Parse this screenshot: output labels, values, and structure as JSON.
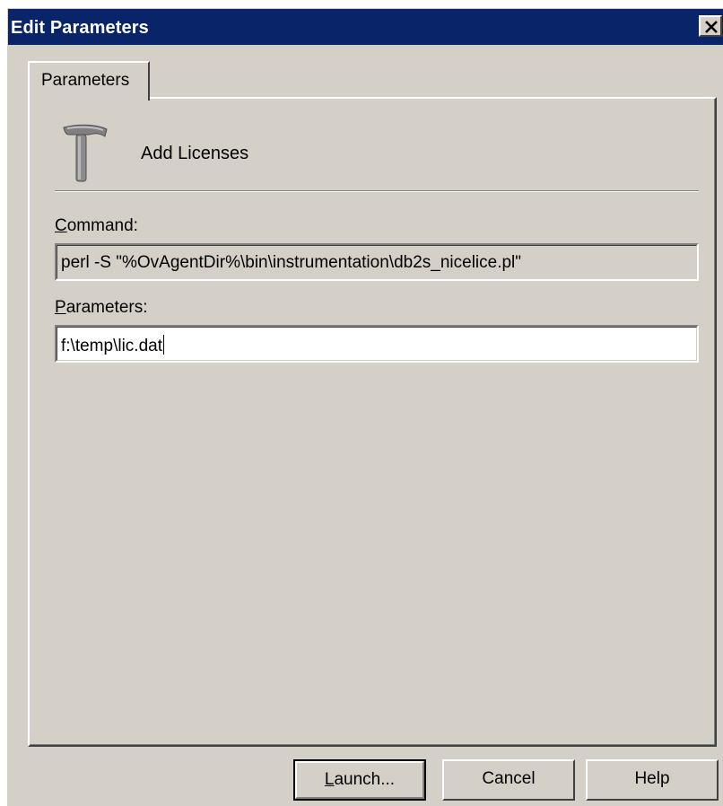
{
  "window": {
    "title": "Edit Parameters",
    "close_glyph": "✕"
  },
  "tabs": [
    {
      "label": "Parameters",
      "active": true
    }
  ],
  "tool": {
    "icon": "hammer-icon",
    "name": "Add Licenses"
  },
  "command": {
    "label_accel": "C",
    "label_rest": "ommand:",
    "value": "perl -S \"%OvAgentDir%\\bin\\instrumentation\\db2s_nicelice.pl\""
  },
  "parameters": {
    "label_accel": "P",
    "label_rest": "arameters:",
    "value": "f:\\temp\\lic.dat"
  },
  "buttons": {
    "launch_accel": "L",
    "launch_rest": "aunch...",
    "cancel": "Cancel",
    "help": "Help"
  },
  "colors": {
    "titlebar": "#0a246a",
    "face": "#d4d0c8"
  }
}
